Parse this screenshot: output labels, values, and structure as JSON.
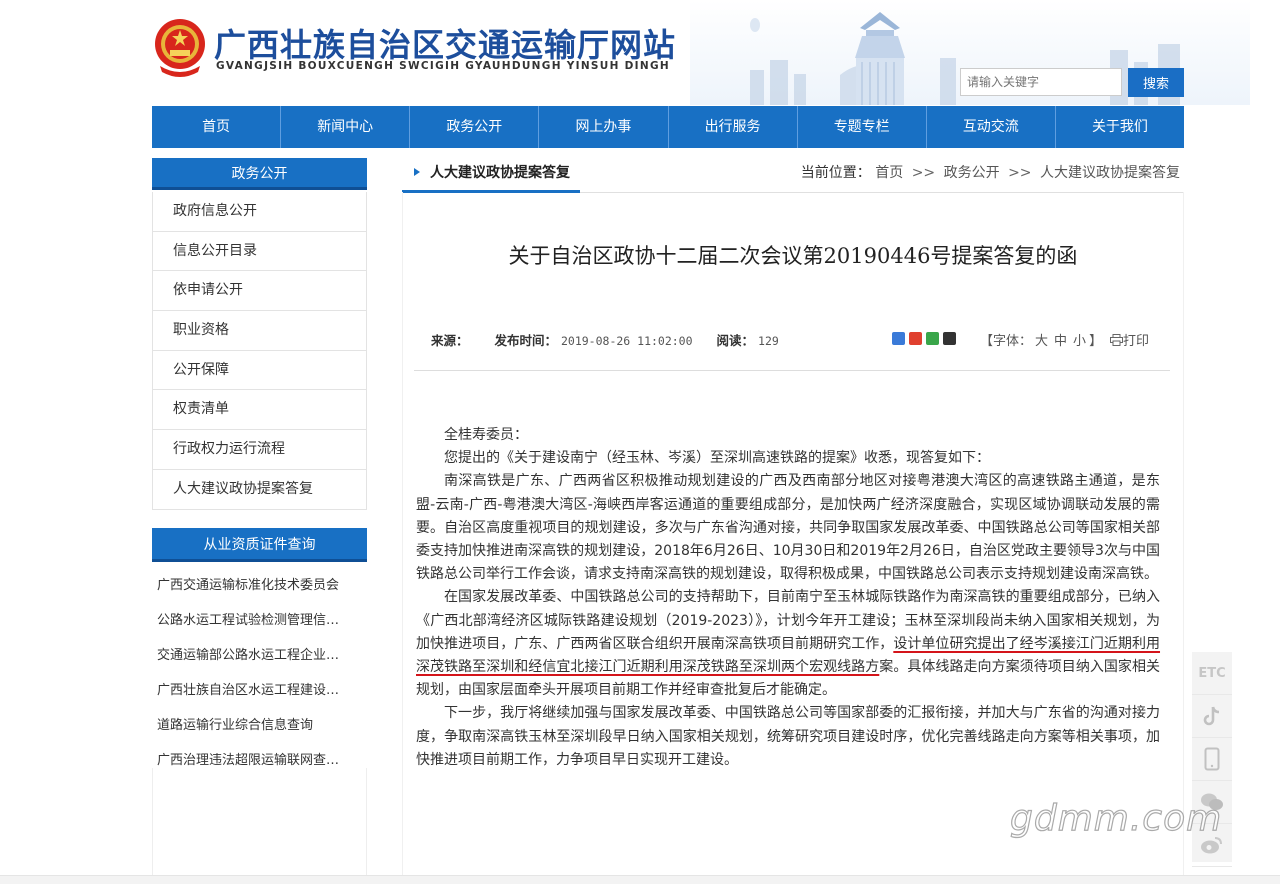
{
  "header": {
    "site_title": "广西壮族自治区交通运输厅网站",
    "site_subtitle": "GVANGJSIH BOUXCUENGH SWCIGIH GYAUHDUNGH YINSUH DINGH",
    "search_placeholder": "请输入关键字",
    "search_button": "搜索"
  },
  "nav": [
    "首页",
    "新闻中心",
    "政务公开",
    "网上办事",
    "出行服务",
    "专题专栏",
    "互动交流",
    "关于我们"
  ],
  "sidebar": {
    "heading": "政务公开",
    "items": [
      "政府信息公开",
      "信息公开目录",
      "依申请公开",
      "职业资格",
      "公开保障",
      "权责清单",
      "行政权力运行流程",
      "人大建议政协提案答复"
    ],
    "links_heading": "从业资质证件查询",
    "links": [
      "广西交通运输标准化技术委员会",
      "公路水运工程试验检测管理信…",
      "交通运输部公路水运工程企业…",
      "广西壮族自治区水运工程建设…",
      "道路运输行业综合信息查询",
      "广西治理违法超限运输联网查…"
    ]
  },
  "section": {
    "tag": "人大建议政协提案答复",
    "breadcrumb_label": "当前位置：",
    "breadcrumb": [
      "首页",
      "政务公开",
      "人大建议政协提案答复"
    ],
    "breadcrumb_sep": ">>"
  },
  "article": {
    "title": "关于自治区政协十二届二次会议第20190446号提案答复的函",
    "meta": {
      "source_label": "来源：",
      "date_label": "发布时间：",
      "date": "2019-08-26 11:02:00",
      "views_label": "阅读：",
      "views": "129"
    },
    "font_label": "【字体：",
    "font_sizes": [
      "大",
      "中",
      "小"
    ],
    "font_close": "】",
    "print": "打印",
    "salutation": "全桂寿委员：",
    "p1": "您提出的《关于建设南宁（经玉林、岑溪）至深圳高速铁路的提案》收悉，现答复如下：",
    "p2": "南深高铁是广东、广西两省区积极推动规划建设的广西及西南部分地区对接粤港澳大湾区的高速铁路主通道，是东盟-云南-广西-粤港澳大湾区-海峡西岸客运通道的重要组成部分，是加快两广经济深度融合，实现区域协调联动发展的需要。自治区高度重视项目的规划建设，多次与广东省沟通对接，共同争取国家发展改革委、中国铁路总公司等国家相关部委支持加快推进南深高铁的规划建设，2018年6月26日、10月30日和2019年2月26日，自治区党政主要领导3次与中国铁路总公司举行工作会谈，请求支持南深高铁的规划建设，取得积极成果，中国铁路总公司表示支持规划建设南深高铁。",
    "p3a": "在国家发展改革委、中国铁路总公司的支持帮助下，目前南宁至玉林城际铁路作为南深高铁的重要组成部分，已纳入《广西北部湾经济区城际铁路建设规划（2019-2023）》，计划今年开工建设；玉林至深圳段尚未纳入国家相关规划，为加快推进项目，广东、广西两省区联合组织开展南深高铁项目前期研究工作，",
    "p3b": "设计单位研究提出了经岑溪接江门近期利用深茂铁路至深圳和经信宜北接江门近期利用深茂铁路至深圳两个宏观线路方",
    "p3c": "案。具体线路走向方案须待项目纳入国家相关规划，由国家层面牵头开展项目前期工作并经审查批复后才能确定。",
    "p4": "下一步，我厅将继续加强与国家发展改革委、中国铁路总公司等国家部委的汇报衔接，并加大与广东省的沟通对接力度，争取南深高铁玉林至深圳段早日纳入国家相关规划，统筹研究项目建设时序，优化完善线路走向方案等相关事项，加快推进项目前期工作，力争项目早日实现开工建设。"
  },
  "float_bar": [
    "ETC",
    "douyin-icon",
    "mobile-icon",
    "wechat-icon",
    "weibo-icon"
  ],
  "watermark": "gdmm.com",
  "colors": {
    "primary": "#1870c4",
    "title_blue": "#1d4e9c",
    "underline_red": "#d4141a"
  }
}
